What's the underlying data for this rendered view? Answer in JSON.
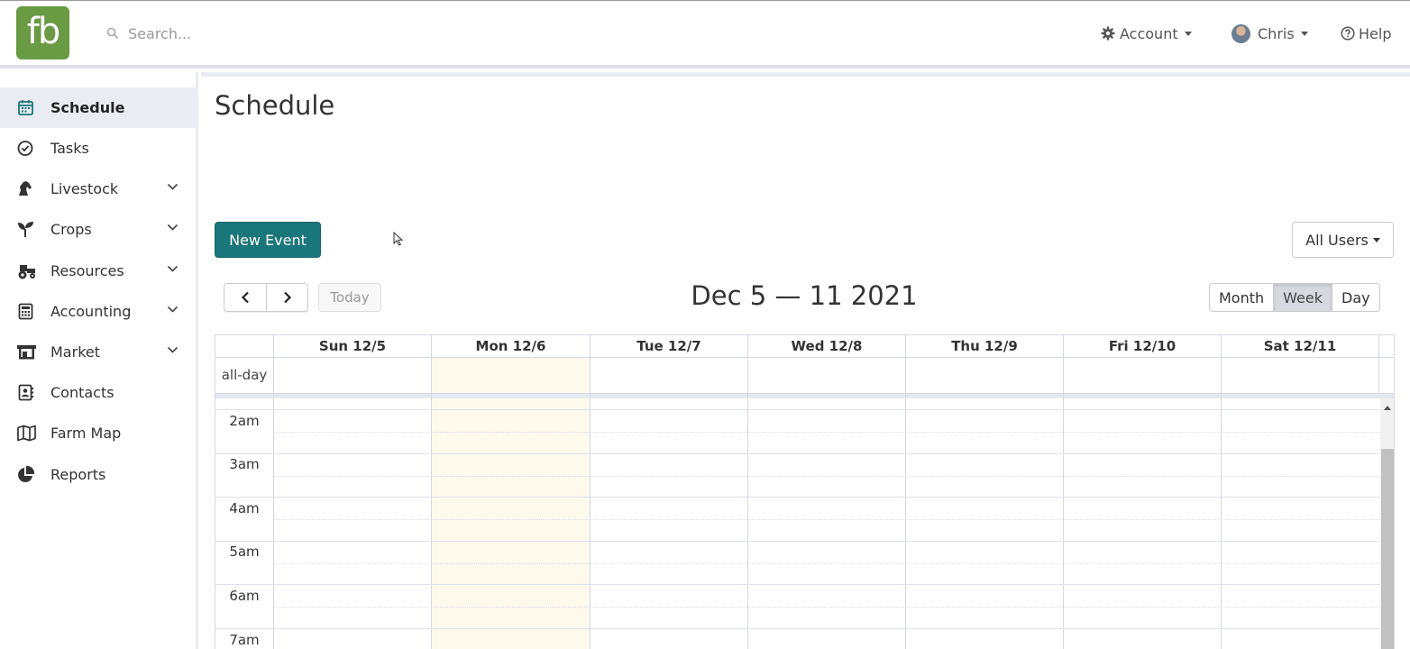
{
  "app": {
    "logo_text": "fb",
    "brand_color": "#6a9a43",
    "accent_color": "#19767a"
  },
  "search": {
    "placeholder": "Search..."
  },
  "topnav": {
    "account_label": "Account",
    "user_label": "Chris",
    "help_label": "Help"
  },
  "sidebar": {
    "items": [
      {
        "label": "Schedule",
        "icon": "calendar-icon",
        "active": true
      },
      {
        "label": "Tasks",
        "icon": "check-circle-icon"
      },
      {
        "label": "Livestock",
        "icon": "horse-icon",
        "expandable": true
      },
      {
        "label": "Crops",
        "icon": "seedling-icon",
        "expandable": true
      },
      {
        "label": "Resources",
        "icon": "tractor-icon",
        "expandable": true
      },
      {
        "label": "Accounting",
        "icon": "calculator-icon",
        "expandable": true
      },
      {
        "label": "Market",
        "icon": "store-icon",
        "expandable": true
      },
      {
        "label": "Contacts",
        "icon": "address-book-icon"
      },
      {
        "label": "Farm Map",
        "icon": "map-icon"
      },
      {
        "label": "Reports",
        "icon": "pie-chart-icon"
      }
    ]
  },
  "main": {
    "title": "Schedule",
    "new_event_label": "New Event",
    "users_filter_label": "All Users"
  },
  "calendar": {
    "today_label": "Today",
    "range_title": "Dec 5 — 11 2021",
    "views": [
      "Month",
      "Week",
      "Day"
    ],
    "active_view": "Week",
    "allday_label": "all-day",
    "days": [
      "Sun 12/5",
      "Mon 12/6",
      "Tue 12/7",
      "Wed 12/8",
      "Thu 12/9",
      "Fri 12/10",
      "Sat 12/11"
    ],
    "highlighted_day": "Mon 12/6",
    "times": [
      "2am",
      "3am",
      "4am",
      "5am",
      "6am",
      "7am"
    ]
  }
}
